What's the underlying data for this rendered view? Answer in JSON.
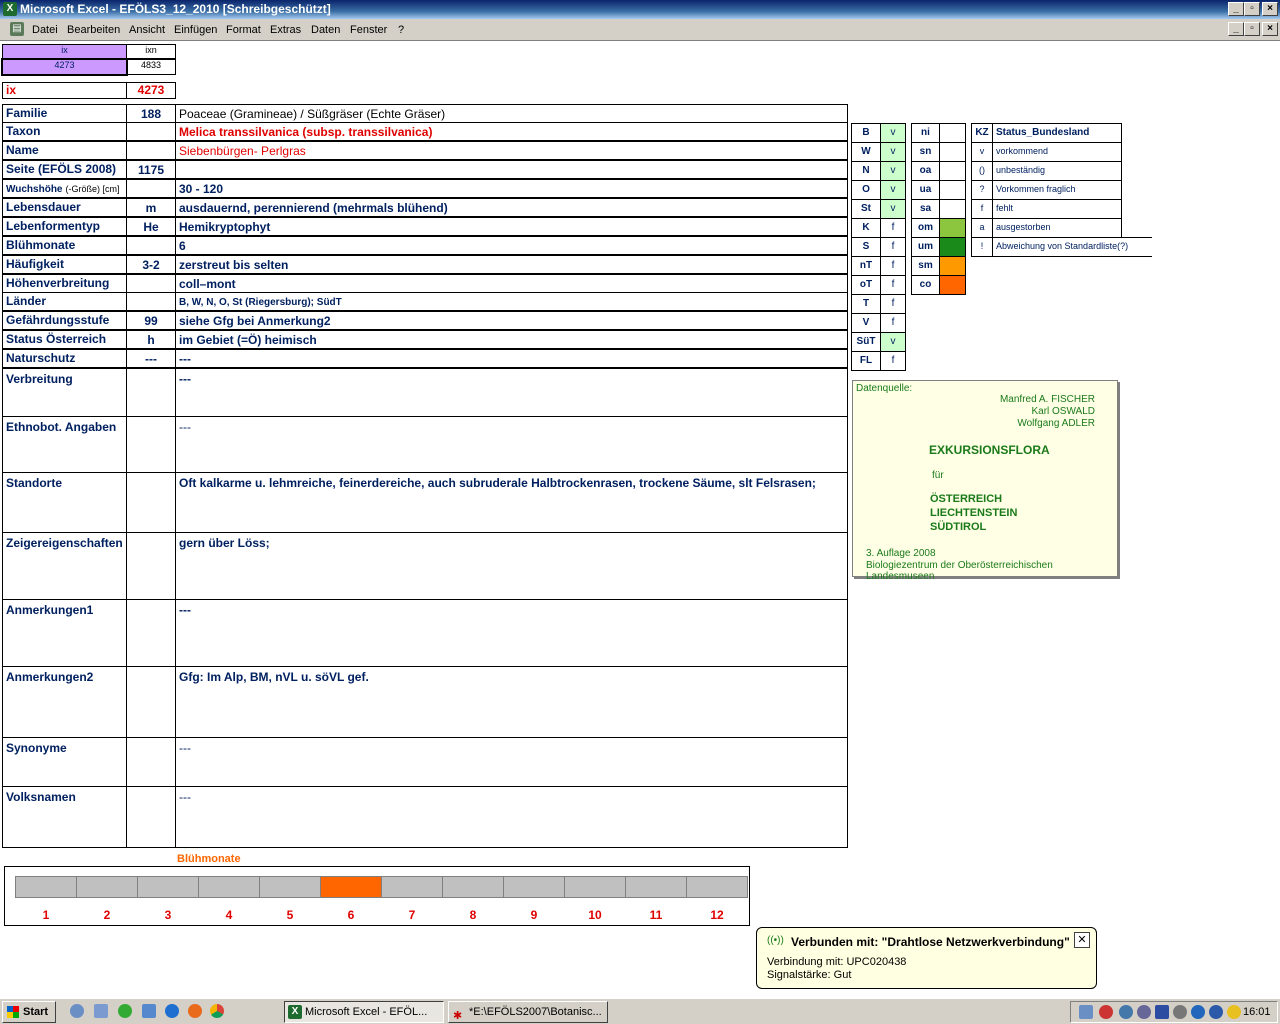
{
  "window": {
    "title": "Microsoft Excel - EFÖLS3_12_2010  [Schreibgeschützt]"
  },
  "menu": [
    "Datei",
    "Bearbeiten",
    "Ansicht",
    "Einfügen",
    "Format",
    "Extras",
    "Daten",
    "Fenster",
    "?"
  ],
  "ix_box": {
    "ix_label": "ix",
    "ixn_label": "ixn",
    "ix_value": "4273",
    "ixn_value": "4833",
    "ix_label2": "ix",
    "ix_value2": "4273"
  },
  "rows": [
    {
      "label": "Familie",
      "code": "188",
      "value": "Poaceae (Gramineae)  /  Süßgräser (Echte Gräser)"
    },
    {
      "label": "Taxon",
      "code": "",
      "value": "Melica transsilvanica (subsp. transsilvanica)"
    },
    {
      "label": "Name",
      "code": "",
      "value": "Siebenbürgen- Perlgras"
    },
    {
      "label": "Seite (EFÖLS 2008)",
      "code": "1175",
      "value": ""
    },
    {
      "label": "Wuchshöhe",
      "label_suffix": "(-Größe) [cm]",
      "code": "",
      "value": " 30 - 120"
    },
    {
      "label": "Lebensdauer",
      "code": "m",
      "value": "ausdauernd, perennierend (mehrmals blühend)"
    },
    {
      "label": "Lebenformentyp",
      "code": "He",
      "value": "Hemikryptophyt"
    },
    {
      "label": "Blühmonate",
      "code": "",
      "value": " 6"
    },
    {
      "label": "Häufigkeit",
      "code": "3-2",
      "value": "zerstreut bis selten"
    },
    {
      "label": "Höhenverbreitung",
      "code": "",
      "value": "coll–mont"
    },
    {
      "label": "Länder",
      "code": "",
      "value": "B, W, N, O, St (Riegersburg); SüdT"
    },
    {
      "label": "Gefährdungsstufe",
      "code": "99",
      "value": "siehe Gfg bei Anmerkung2"
    },
    {
      "label": "Status Österreich",
      "code": "h",
      "value": "im Gebiet (=Ö) heimisch"
    },
    {
      "label": "Naturschutz",
      "code": "---",
      "value": "---"
    }
  ],
  "tall_rows": [
    {
      "label": "Verbreitung",
      "value": " ---"
    },
    {
      "label": "Ethnobot. Angaben",
      "value": "---"
    },
    {
      "label": "Standorte",
      "value": "Oft kalkarme u. lehmreiche, feinerdereiche, auch subruderale Halbtrockenrasen, trockene Säume, slt Felsrasen;"
    },
    {
      "label": "Zeigereigenschaften",
      "value": "gern über Löss;"
    },
    {
      "label": "Anmerkungen1",
      "value": "---"
    },
    {
      "label": "Anmerkungen2",
      "value": "Gfg: Im Alp, BM, nVL u. söVL gef."
    },
    {
      "label": "Synonyme",
      "value": "---"
    },
    {
      "label": "Volksnamen",
      "value": "---"
    }
  ],
  "state_table": [
    {
      "code": "B",
      "status": "v"
    },
    {
      "code": "W",
      "status": "v"
    },
    {
      "code": "N",
      "status": "v"
    },
    {
      "code": "O",
      "status": "v"
    },
    {
      "code": "St",
      "status": "v"
    },
    {
      "code": "K",
      "status": "f"
    },
    {
      "code": "S",
      "status": "f"
    },
    {
      "code": "nT",
      "status": "f"
    },
    {
      "code": "oT",
      "status": "f"
    },
    {
      "code": "T",
      "status": "f"
    },
    {
      "code": "V",
      "status": "f"
    },
    {
      "code": "SüT",
      "status": "v"
    },
    {
      "code": "FL",
      "status": "f"
    }
  ],
  "zone_table": [
    {
      "code": "ni",
      "color": ""
    },
    {
      "code": "sn",
      "color": ""
    },
    {
      "code": "oa",
      "color": ""
    },
    {
      "code": "ua",
      "color": ""
    },
    {
      "code": "sa",
      "color": ""
    },
    {
      "code": "om",
      "color": "#8cc63f"
    },
    {
      "code": "um",
      "color": "#1a8a1a"
    },
    {
      "code": "sm",
      "color": "#ff9900"
    },
    {
      "code": "co",
      "color": "#ff6600"
    }
  ],
  "legend_header": {
    "kz": "KZ",
    "title": "Status_Bundesland"
  },
  "legend": [
    {
      "kz": "v",
      "text": "vorkommend"
    },
    {
      "kz": "()",
      "text": "unbeständig"
    },
    {
      "kz": "?",
      "text": "Vorkommen fraglich"
    },
    {
      "kz": "f",
      "text": "fehlt"
    },
    {
      "kz": "a",
      "text": "ausgestorben"
    },
    {
      "kz": "!",
      "text": "Abweichung von Standardliste(?)"
    }
  ],
  "datasource": {
    "label": "Datenquelle:",
    "author1": "Manfred A. FISCHER",
    "author2": "Karl OSWALD",
    "author3": "Wolfgang ADLER",
    "title": "EXKURSIONSFLORA",
    "fuer": "für",
    "country1": "ÖSTERREICH",
    "country2": "LIECHTENSTEIN",
    "country3": "SÜDTIROL",
    "edition": "3. Auflage 2008",
    "publisher": "Biologiezentrum der Oberösterreichischen Landesmuseen"
  },
  "months": {
    "title": "Blühmonate",
    "labels": [
      "1",
      "2",
      "3",
      "4",
      "5",
      "6",
      "7",
      "8",
      "9",
      "10",
      "11",
      "12"
    ],
    "flowering": [
      6
    ],
    "active_color": "#ff6600"
  },
  "balloon": {
    "title": "Verbunden mit: \"Drahtlose Netzwerkverbindung\"",
    "line1": "Verbindung mit: UPC020438",
    "line2": "Signalstärke: Gut"
  },
  "taskbar": {
    "start": "Start",
    "task1": "Microsoft Excel - EFÖL...",
    "task2": "*E:\\EFÖLS2007\\Botanisc...",
    "clock": "16:01"
  }
}
